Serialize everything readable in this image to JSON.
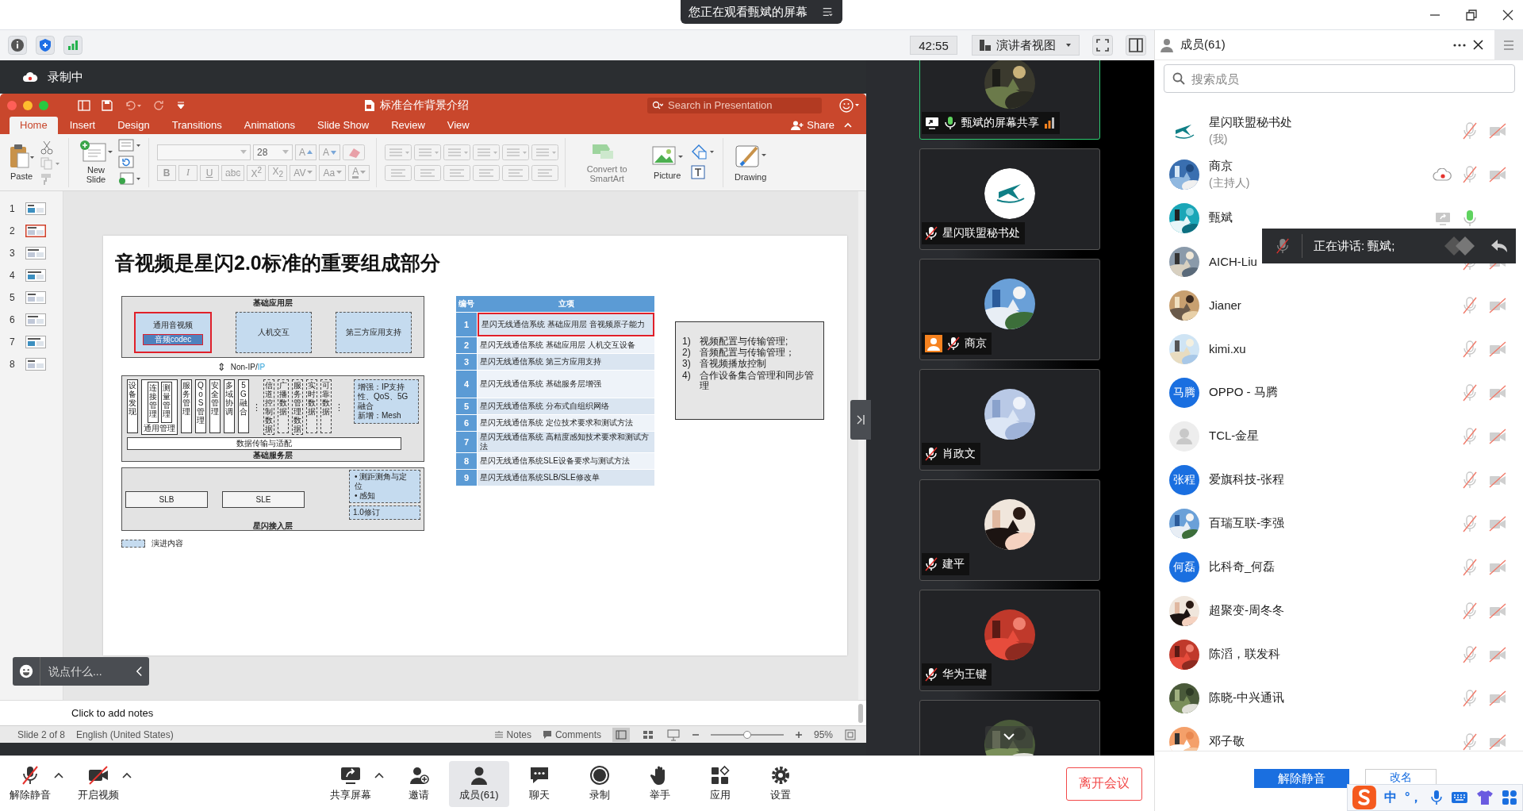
{
  "window": {
    "banner": "您正在观看甄斌的屏幕"
  },
  "toolbar": {
    "timer": "42:55",
    "view_mode": "演讲者视图"
  },
  "recording": {
    "label": "录制中"
  },
  "ppt": {
    "title": "标准合作背景介绍",
    "search_placeholder": "Search in Presentation",
    "tabs": [
      {
        "label": "Home",
        "selected": true
      },
      {
        "label": "Insert",
        "selected": false
      },
      {
        "label": "Design",
        "selected": false
      },
      {
        "label": "Transitions",
        "selected": false
      },
      {
        "label": "Animations",
        "selected": false
      },
      {
        "label": "Slide Show",
        "selected": false
      },
      {
        "label": "Review",
        "selected": false
      },
      {
        "label": "View",
        "selected": false
      }
    ],
    "share": "Share",
    "ribbon": {
      "paste": "Paste",
      "new_slide": "New Slide",
      "font_size": "28",
      "size_buttons": [
        {
          "text": "A",
          "kind": "grow"
        },
        {
          "text": "A",
          "kind": "shrink"
        }
      ],
      "format_buttons": [
        {
          "text": "B",
          "kind": "bold"
        },
        {
          "text": "I",
          "kind": "italic"
        },
        {
          "text": "U",
          "kind": "underline"
        },
        {
          "text": "abc",
          "kind": "strike"
        },
        {
          "text": "X$^{2}$",
          "kind": "plain"
        },
        {
          "text": "X$_{2}$",
          "kind": "plain"
        },
        {
          "text": "AV",
          "kind": "caret"
        },
        {
          "text": "Aa",
          "kind": "caret"
        },
        {
          "text": "A",
          "kind": "color"
        }
      ],
      "smartart": "Convert to SmartArt",
      "picture": "Picture",
      "drawing": "Drawing"
    },
    "thumbnails": [
      {
        "number": "1",
        "selected": false
      },
      {
        "number": "2",
        "selected": true
      },
      {
        "number": "3",
        "selected": false
      },
      {
        "number": "4",
        "selected": false
      },
      {
        "number": "5",
        "selected": false
      },
      {
        "number": "6",
        "selected": false
      },
      {
        "number": "7",
        "selected": false
      },
      {
        "number": "8",
        "selected": false
      }
    ],
    "slide": {
      "title": "音视频是星闪2.0标准的重要组成部分",
      "app_layer": {
        "label": "基础应用层",
        "boxes": [
          {
            "text": "通用音视频",
            "sub": "音频codec",
            "kind": "highlight"
          },
          {
            "text": "人机交互",
            "kind": "dashed"
          },
          {
            "text": "第三方应用支持",
            "kind": "dashed"
          }
        ]
      },
      "interface": {
        "arrow": "⇕",
        "text": "Non-IP/",
        "accent": "IP"
      },
      "service_layer": {
        "label": "基础服务层",
        "transport": "数据传输与适配",
        "note": [
          "增强：IP支持性、QoS、5G融合",
          "新增：Mesh"
        ],
        "modules": [
          {
            "kind": "solid",
            "text": "设备发现"
          },
          {
            "kind": "group",
            "text": "通用管理",
            "children": [
              "连接管理",
              "测量管理"
            ]
          },
          {
            "kind": "solid",
            "text": "服务管理"
          },
          {
            "kind": "solid",
            "text": "QoS管理"
          },
          {
            "kind": "solid",
            "text": "安全管理"
          },
          {
            "kind": "solid",
            "text": "多域协调"
          },
          {
            "kind": "solid",
            "text": "5G融合"
          },
          {
            "kind": "more",
            "text": "⋮"
          },
          {
            "kind": "dashed",
            "text": "信道控制数据"
          },
          {
            "kind": "dashed",
            "text": "广播数据"
          },
          {
            "kind": "dashed",
            "text": "服务管理数据"
          },
          {
            "kind": "dashed",
            "text": "实时数据"
          },
          {
            "kind": "dashed",
            "text": "可靠数据"
          },
          {
            "kind": "more",
            "text": "⋮"
          }
        ]
      },
      "access_layer": {
        "label": "星闪接入层",
        "blocks": [
          "SLB",
          "SLE"
        ],
        "features": [
          "• 测距测角与定位",
          "• 感知"
        ],
        "revision": "1.0修订"
      },
      "legend": "演进内容",
      "table": {
        "columns": [
          "编号",
          "立项"
        ],
        "rows": [
          {
            "no": "1",
            "text": "星闪无线通信系统 基础应用层 音视频原子能力",
            "highlighted": true
          },
          {
            "no": "2",
            "text": "星闪无线通信系统 基础应用层 人机交互设备",
            "highlighted": false
          },
          {
            "no": "3",
            "text": "星闪无线通信系统 第三方应用支持",
            "highlighted": false
          },
          {
            "no": "4",
            "text": "星闪无线通信系统 基础服务层增强",
            "highlighted": false
          },
          {
            "no": "5",
            "text": "星闪无线通信系统 分布式自组织网络",
            "highlighted": false
          },
          {
            "no": "6",
            "text": "星闪无线通信系统 定位技术要求和测试方法",
            "highlighted": false
          },
          {
            "no": "7",
            "text": "星闪无线通信系统 高精度感知技术要求和测试方法",
            "highlighted": false
          },
          {
            "no": "8",
            "text": "星闪无线通信系统SLE设备要求与测试方法",
            "highlighted": false
          },
          {
            "no": "9",
            "text": "星闪无线通信系统SLB/SLE修改单",
            "highlighted": false
          }
        ]
      },
      "goals": [
        {
          "no": "1)",
          "text": "视频配置与传输管理;"
        },
        {
          "no": "2)",
          "text": "音频配置与传输管理；"
        },
        {
          "no": "3)",
          "text": "音视频播放控制"
        },
        {
          "no": "4)",
          "text": "合作设备集合管理和同步管理"
        }
      ]
    },
    "notes_placeholder": "Click to add notes",
    "status": {
      "slide": "Slide 2 of 8",
      "language": "English (United States)",
      "notes": "Notes",
      "comments": "Comments",
      "zoom": {
        "level": 0.5
      },
      "zoom_reading": "95%"
    }
  },
  "chat": {
    "placeholder": "说点什么..."
  },
  "video_tiles": [
    {
      "name": "甄斌的屏幕共享",
      "kind": "picture",
      "muted": false,
      "sharing": true,
      "host": false,
      "signal": true,
      "selected": true
    },
    {
      "name": "星闪联盟秘书处",
      "kind": "logo",
      "muted": true,
      "sharing": false,
      "host": false,
      "signal": false,
      "selected": false
    },
    {
      "name": "商京",
      "kind": "picture",
      "muted": true,
      "sharing": false,
      "host": true,
      "signal": false,
      "selected": false
    },
    {
      "name": "肖政文",
      "kind": "picture",
      "muted": true,
      "sharing": false,
      "host": false,
      "signal": false,
      "selected": false
    },
    {
      "name": "建平",
      "kind": "picture",
      "muted": true,
      "sharing": false,
      "host": false,
      "signal": false,
      "selected": false
    },
    {
      "name": "华为王键",
      "kind": "picture",
      "muted": true,
      "sharing": false,
      "host": false,
      "signal": false,
      "selected": false
    },
    {
      "kind": "picture",
      "selected": false
    }
  ],
  "members": {
    "title": "成员(61)",
    "search_placeholder": "搜索成员",
    "speaking": "正在讲话: 甄斌;",
    "unmute_button": "解除静音",
    "rename_button": "改名",
    "list": [
      {
        "name": "星闪联盟秘书处",
        "sub": "(我)",
        "kind": "logo",
        "muted": true,
        "sharing": false,
        "recording": false
      },
      {
        "name": "商京",
        "sub": "(主持人)",
        "kind": "picture",
        "muted": true,
        "sharing": false,
        "recording": true
      },
      {
        "name": "甄斌",
        "kind": "picture",
        "muted": false,
        "sharing": true,
        "recording": false
      },
      {
        "name": "AICH-Liu",
        "kind": "picture",
        "muted": true,
        "sharing": false,
        "recording": false
      },
      {
        "name": "Jianer",
        "kind": "picture",
        "muted": true,
        "sharing": false,
        "recording": false
      },
      {
        "name": "kimi.xu",
        "kind": "picture",
        "muted": true,
        "sharing": false,
        "recording": false
      },
      {
        "name": "OPPO - 马腾",
        "kind": "text",
        "avatar_text": "马腾",
        "muted": true,
        "sharing": false,
        "recording": false
      },
      {
        "name": "TCL-金星",
        "kind": "default",
        "muted": true,
        "sharing": false,
        "recording": false
      },
      {
        "name": "爱旗科技-张程",
        "kind": "text",
        "avatar_text": "张程",
        "muted": true,
        "sharing": false,
        "recording": false
      },
      {
        "name": "百瑞互联-李强",
        "kind": "picture",
        "muted": true,
        "sharing": false,
        "recording": false
      },
      {
        "name": "比科奇_何磊",
        "kind": "text",
        "avatar_text": "何磊",
        "muted": true,
        "sharing": false,
        "recording": false
      },
      {
        "name": "超聚变-周冬冬",
        "kind": "picture",
        "muted": true,
        "sharing": false,
        "recording": false
      },
      {
        "name": "陈滔，联发科",
        "kind": "picture",
        "muted": true,
        "sharing": false,
        "recording": false
      },
      {
        "name": "陈晓-中兴通讯",
        "kind": "picture",
        "muted": true,
        "sharing": false,
        "recording": false
      },
      {
        "name": "邓子敬",
        "kind": "picture",
        "muted": true,
        "sharing": false,
        "recording": false
      }
    ]
  },
  "ime": {
    "mode": "中",
    "punct": "°，"
  },
  "bottom_bar": {
    "buttons": [
      {
        "label": "解除静音",
        "kind": "mic_off",
        "caret": true,
        "selected": false
      },
      {
        "label": "开启视频",
        "kind": "camera_off",
        "caret": true,
        "selected": false
      },
      {
        "label": "共享屏幕",
        "kind": "share",
        "caret": true,
        "selected": false
      },
      {
        "label": "邀请",
        "kind": "invite",
        "caret": false,
        "selected": false
      },
      {
        "label": "成员(61)",
        "kind": "members",
        "caret": false,
        "selected": true
      },
      {
        "label": "聊天",
        "kind": "chat",
        "caret": false,
        "selected": false
      },
      {
        "label": "录制",
        "kind": "record",
        "caret": false,
        "selected": false
      },
      {
        "label": "举手",
        "kind": "hand",
        "caret": false,
        "selected": false
      },
      {
        "label": "应用",
        "kind": "apps",
        "caret": false,
        "selected": false
      },
      {
        "label": "设置",
        "kind": "settings",
        "caret": false,
        "selected": false
      }
    ],
    "leave": "离开会议"
  }
}
